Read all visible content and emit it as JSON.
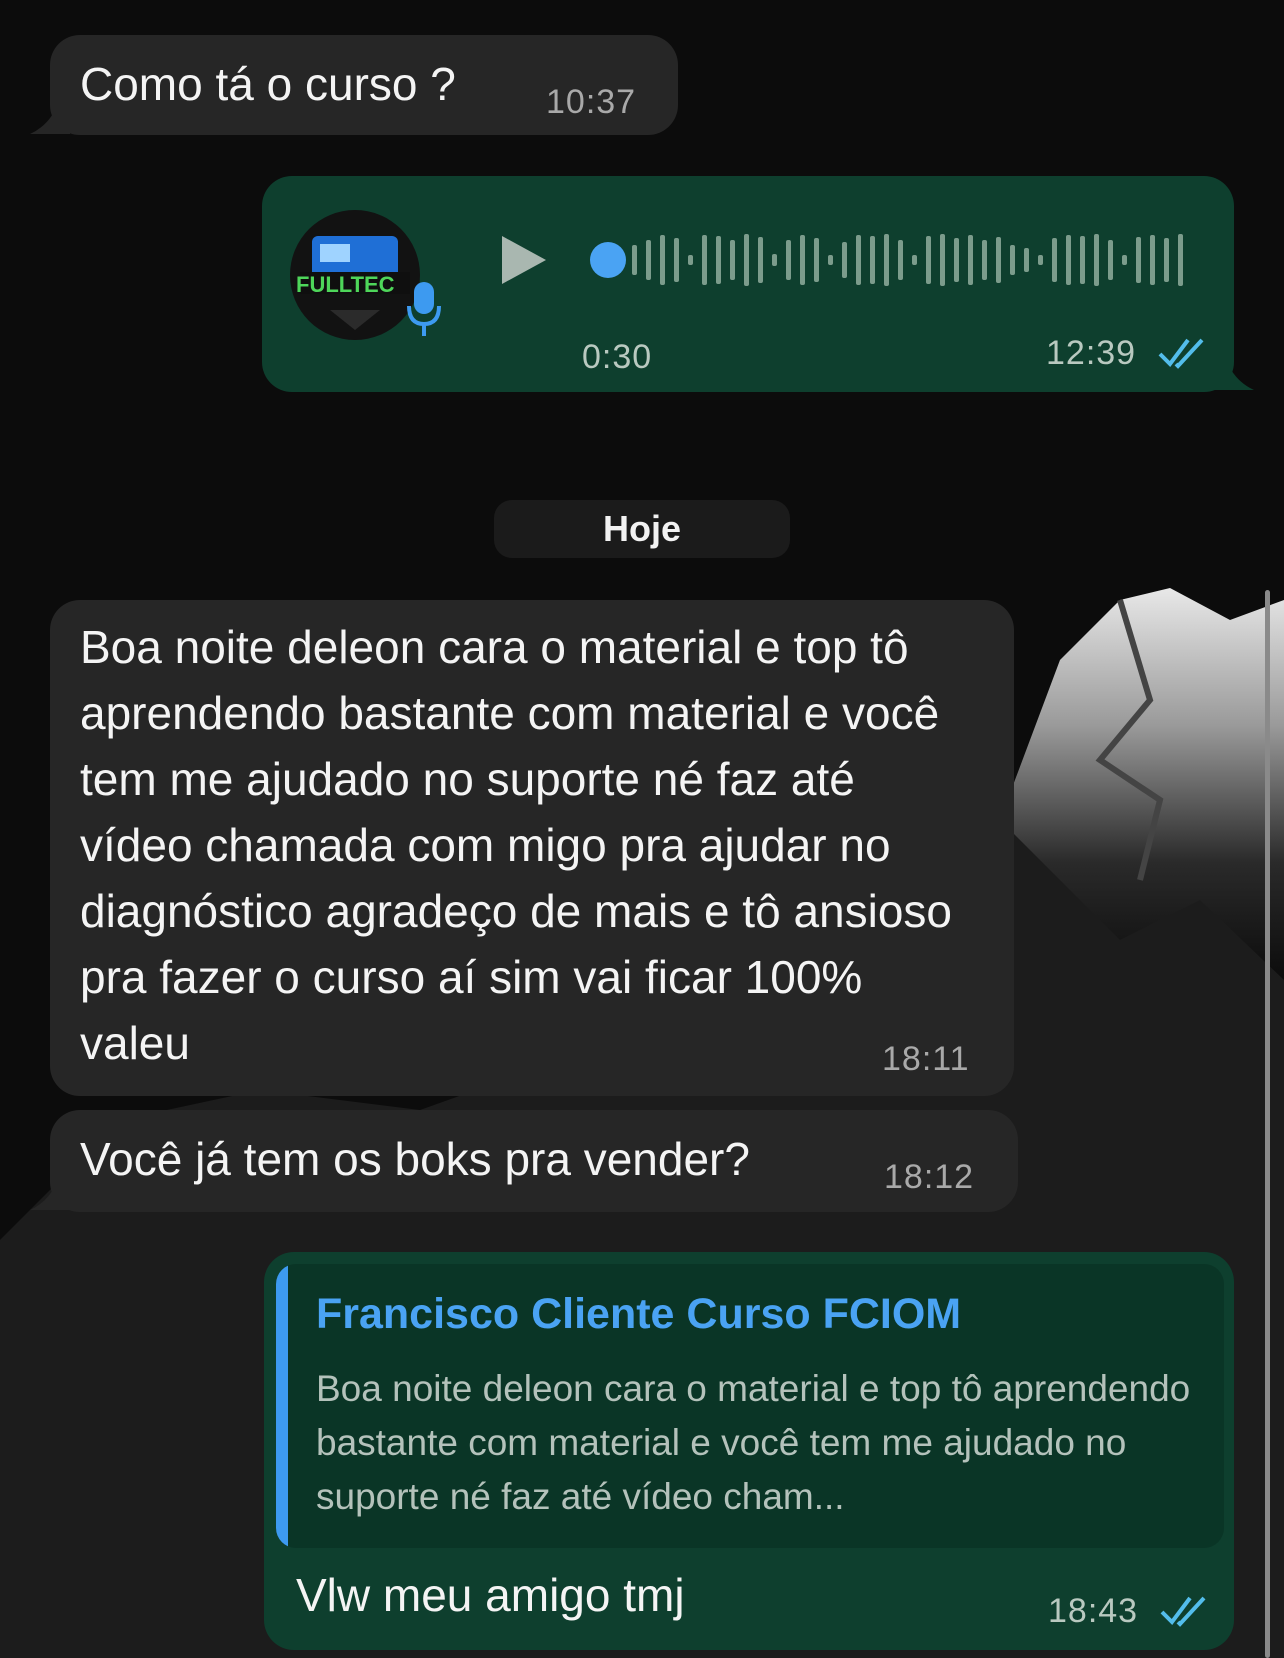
{
  "messages": [
    {
      "text": "Como tá o curso ?",
      "time": "10:37"
    },
    {
      "duration": "0:30",
      "time": "12:39",
      "avatar_caption": "FULLTEC"
    },
    {
      "text": "Boa noite deleon cara o material e top tô aprendendo bastante com material e você tem me ajudado no suporte né faz até vídeo chamada com migo pra ajudar no diagnóstico agradeço de mais e tô ansioso pra fazer o curso aí sim vai ficar 100% valeu",
      "time": "18:11"
    },
    {
      "text": "Você já tem os boks pra vender?",
      "time": "18:12"
    },
    {
      "quote_name": "Francisco Cliente Curso FCIOM",
      "quote_text": "Boa noite deleon cara o material e top tô aprendendo bastante com material e você tem me ajudado no suporte né faz até vídeo cham...",
      "text": "Vlw meu amigo tmj",
      "time": "18:43"
    }
  ],
  "date_separator": "Hoje",
  "colors": {
    "incoming": "#262626",
    "outgoing": "#0e3f2e",
    "quote_accent": "#3d9af0",
    "read_ticks": "#53bdeb"
  },
  "icons": [
    "play-icon",
    "mic-icon",
    "double-check-icon"
  ]
}
